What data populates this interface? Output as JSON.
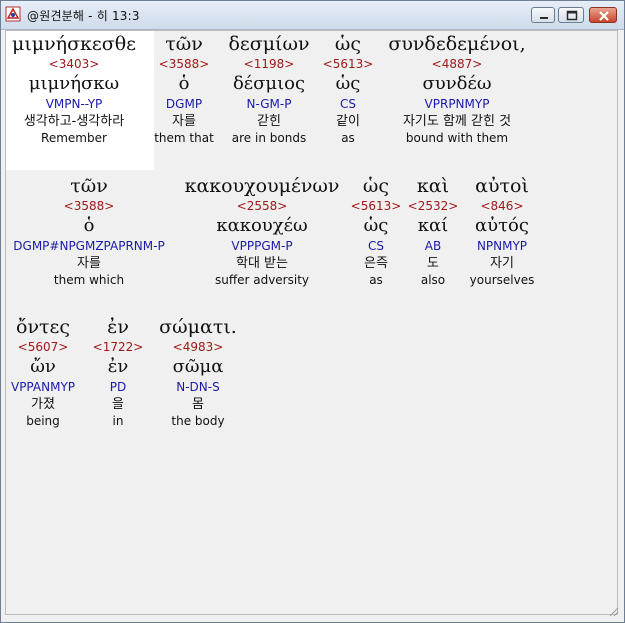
{
  "window": {
    "title": "@원견분해 - 히 13:3",
    "minimize": "minimize",
    "maximize": "maximize",
    "close": "close"
  },
  "lines": [
    [
      {
        "greek": "μιμνήσκεσθε",
        "strongs": "<3403>",
        "lemma": "μιμνήσκω",
        "parsing": "VMPN--YP",
        "korean": "생각하고-생각하라",
        "english": "Remember"
      },
      {
        "greek": "τῶν",
        "strongs": "<3588>",
        "lemma": "ὁ",
        "parsing": "DGMP",
        "korean": "자를",
        "english": "them that"
      },
      {
        "greek": "δεσμίων",
        "strongs": "<1198>",
        "lemma": "δέσμιος",
        "parsing": "N-GM-P",
        "korean": "갇힌",
        "english": "are in bonds"
      },
      {
        "greek": "ὡς",
        "strongs": "<5613>",
        "lemma": "ὡς",
        "parsing": "CS",
        "korean": "같이",
        "english": "as"
      },
      {
        "greek": "συνδεδεμένοι,",
        "strongs": "<4887>",
        "lemma": "συνδέω",
        "parsing": "VPRPNMYP",
        "korean": "자기도 함께 갇힌 것",
        "english": "bound with them"
      }
    ],
    [
      {
        "greek": "τῶν",
        "strongs": "<3588>",
        "lemma": "ὁ",
        "parsing": "DGMP#NPGMZPAPRNM-P",
        "korean": "자를",
        "english": "them which"
      },
      {
        "greek": "κακουχουμένων",
        "strongs": "<2558>",
        "lemma": "κακουχέω",
        "parsing": "VPPPGM-P",
        "korean": "학대 받는",
        "english": "suffer adversity"
      },
      {
        "greek": "ὡς",
        "strongs": "<5613>",
        "lemma": "ὡς",
        "parsing": "CS",
        "korean": "은즉",
        "english": "as"
      },
      {
        "greek": "καὶ",
        "strongs": "<2532>",
        "lemma": "καί",
        "parsing": "AB",
        "korean": "도",
        "english": "also"
      },
      {
        "greek": "αὐτοὶ",
        "strongs": "<846>",
        "lemma": "αὐτός",
        "parsing": "NPNMYP",
        "korean": "자기",
        "english": "yourselves"
      }
    ],
    [
      {
        "greek": "ὄντες",
        "strongs": "<5607>",
        "lemma": "ὤν",
        "parsing": "VPPANMYP",
        "korean": "가졌",
        "english": "being"
      },
      {
        "greek": "ἐν",
        "strongs": "<1722>",
        "lemma": "ἐν",
        "parsing": "PD",
        "korean": "을",
        "english": "in"
      },
      {
        "greek": "σώματι.",
        "strongs": "<4983>",
        "lemma": "σῶμα",
        "parsing": "N-DN-S",
        "korean": "몸",
        "english": "the body"
      }
    ]
  ]
}
